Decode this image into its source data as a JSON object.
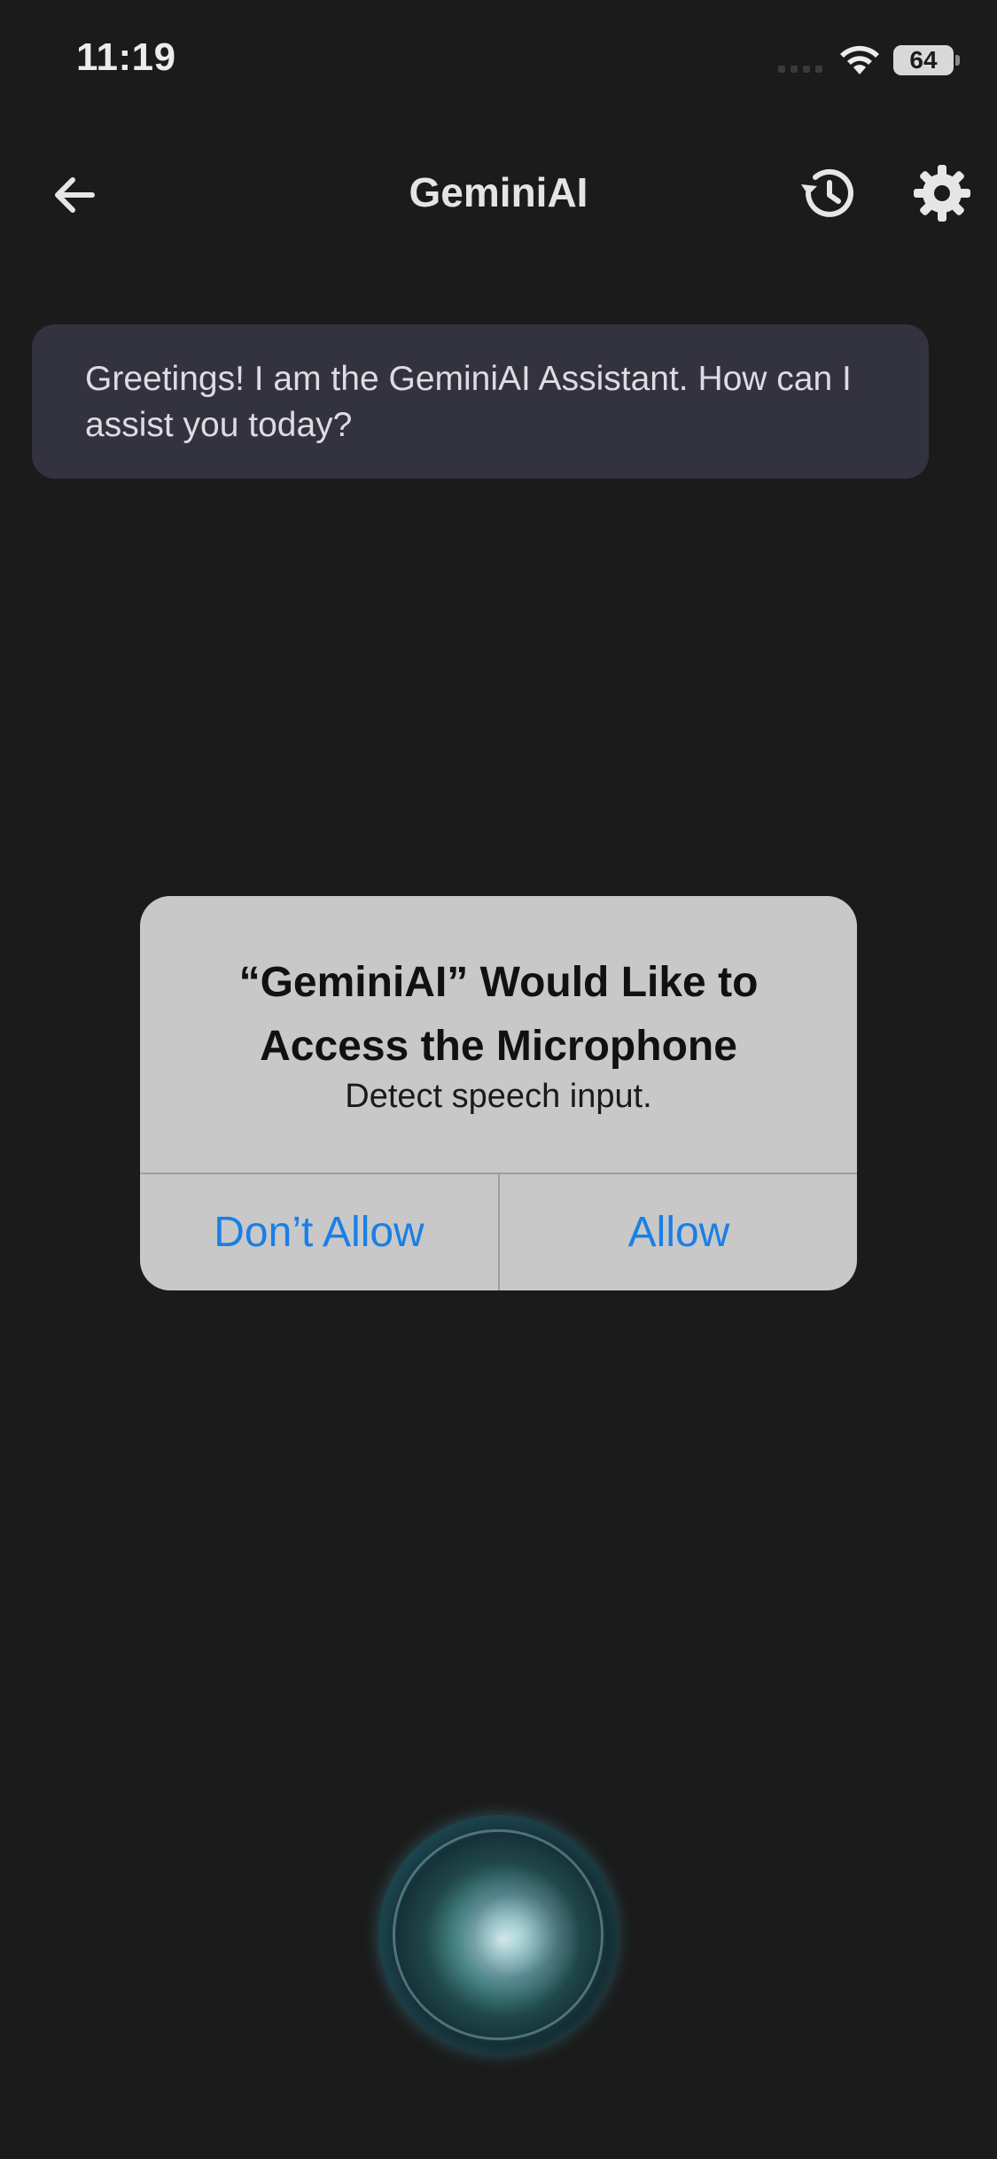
{
  "status_bar": {
    "time": "11:19",
    "battery": "64"
  },
  "header": {
    "title": "GeminiAI"
  },
  "chat": {
    "greeting": "Greetings! I am the GeminiAI Assistant. How can I assist you today?"
  },
  "alert": {
    "title_line1": "“GeminiAI” Would Like to",
    "title_line2": "Access the Microphone",
    "message": "Detect speech input.",
    "deny_label": "Don’t Allow",
    "allow_label": "Allow"
  },
  "colors": {
    "background": "#1b1b1b",
    "bubble": "#33323f",
    "alert_bg": "#c8c8c8",
    "ios_blue": "#1a7fe6"
  },
  "icons": {
    "back": "arrow-left-icon",
    "history": "history-icon",
    "settings": "gear-icon",
    "wifi": "wifi-icon",
    "orb": "voice-orb"
  }
}
